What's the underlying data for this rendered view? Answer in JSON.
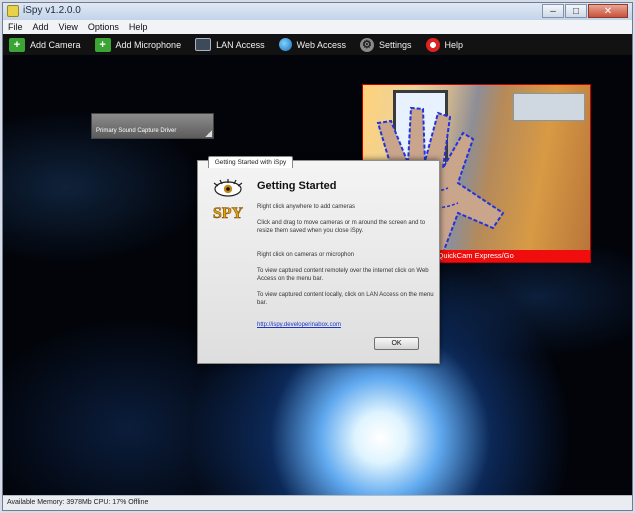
{
  "window": {
    "title": "iSpy v1.2.0.0",
    "buttons": {
      "minimize": "–",
      "maximize": "□",
      "close": "✕"
    }
  },
  "menu": {
    "file": "File",
    "add": "Add",
    "view": "View",
    "options": "Options",
    "help": "Help"
  },
  "toolbar": {
    "add_camera": "Add Camera",
    "add_microphone": "Add Microphone",
    "lan_access": "LAN Access",
    "web_access": "Web Access",
    "settings": "Settings",
    "help": "Help"
  },
  "audio_source": {
    "label": "Primary Sound Capture Driver"
  },
  "camera": {
    "status": "11.48 FPS, Logitech QuickCam Express/Go"
  },
  "dialog": {
    "tab": "Getting Started with iSpy",
    "logo_text": "SPY",
    "heading": "Getting Started",
    "p1": "Right click anywhere to add cameras",
    "p2": "Click and drag to move cameras or m around the screen and to resize them saved when you close iSpy.",
    "p3": "Right click on cameras or microphon",
    "p4": "To view captured content remotely over the internet click on Web Access on the menu bar.",
    "p5": "To view captured content locally, click on LAN Access on the menu bar.",
    "link": "http://ispy.developerinabox.com",
    "ok": "OK"
  },
  "status_bar": {
    "text": "Available Memory: 3978Mb CPU: 17% Offline"
  },
  "colors": {
    "camera_status_bg": "#ef0d0d",
    "toolbar_bg": "#121212",
    "link": "#1a36c9"
  }
}
